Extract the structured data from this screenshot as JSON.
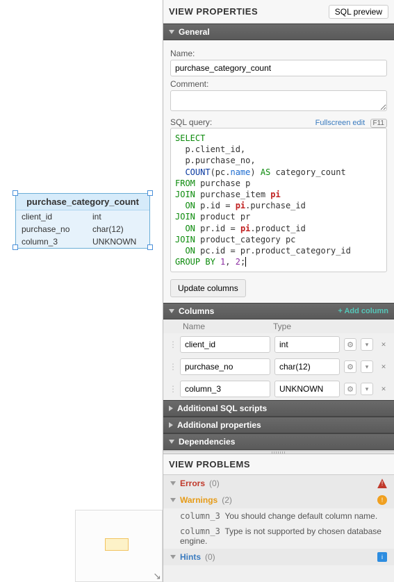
{
  "canvas": {
    "table": {
      "name": "purchase_category_count",
      "columns": [
        {
          "name": "client_id",
          "type": "int"
        },
        {
          "name": "purchase_no",
          "type": "char(12)"
        },
        {
          "name": "column_3",
          "type": "UNKNOWN"
        }
      ]
    }
  },
  "panel": {
    "view_properties_title": "VIEW PROPERTIES",
    "sql_preview_btn": "SQL preview",
    "general": {
      "title": "General",
      "name_label": "Name:",
      "name_value": "purchase_category_count",
      "comment_label": "Comment:",
      "comment_value": "",
      "sql_label": "SQL query:",
      "fullscreen_link": "Fullscreen edit",
      "fullscreen_kbd": "F11",
      "update_btn": "Update columns",
      "sql_tokens": [
        [
          "kw-green",
          "SELECT"
        ],
        [
          "nl",
          ""
        ],
        [
          "indent",
          ""
        ],
        [
          "txt",
          "p.client_id,"
        ],
        [
          "nl",
          ""
        ],
        [
          "indent",
          ""
        ],
        [
          "txt",
          "p.purchase_no,"
        ],
        [
          "nl",
          ""
        ],
        [
          "indent",
          ""
        ],
        [
          "kw-navy",
          "COUNT"
        ],
        [
          "txt",
          "(pc."
        ],
        [
          "kw-blue",
          "name"
        ],
        [
          "txt",
          ") "
        ],
        [
          "kw-green",
          "AS"
        ],
        [
          "txt",
          " category_count"
        ],
        [
          "nl",
          ""
        ],
        [
          "kw-green",
          "FROM"
        ],
        [
          "txt",
          " purchase p"
        ],
        [
          "nl",
          ""
        ],
        [
          "kw-green",
          "JOIN"
        ],
        [
          "txt",
          " purchase_item "
        ],
        [
          "kw-red",
          "pi"
        ],
        [
          "nl",
          ""
        ],
        [
          "indent",
          ""
        ],
        [
          "kw-green",
          "ON"
        ],
        [
          "txt",
          " p.id = "
        ],
        [
          "kw-red",
          "pi"
        ],
        [
          "txt",
          ".purchase_id"
        ],
        [
          "nl",
          ""
        ],
        [
          "kw-green",
          "JOIN"
        ],
        [
          "txt",
          " product pr"
        ],
        [
          "nl",
          ""
        ],
        [
          "indent",
          ""
        ],
        [
          "kw-green",
          "ON"
        ],
        [
          "txt",
          " pr.id = "
        ],
        [
          "kw-red",
          "pi"
        ],
        [
          "txt",
          ".product_id"
        ],
        [
          "nl",
          ""
        ],
        [
          "kw-green",
          "JOIN"
        ],
        [
          "txt",
          " product_category pc"
        ],
        [
          "nl",
          ""
        ],
        [
          "indent",
          ""
        ],
        [
          "kw-green",
          "ON"
        ],
        [
          "txt",
          " pc.id = pr.product_category_id"
        ],
        [
          "nl",
          ""
        ],
        [
          "kw-green",
          "GROUP"
        ],
        [
          "txt",
          " "
        ],
        [
          "kw-green",
          "BY"
        ],
        [
          "txt",
          " "
        ],
        [
          "kw-purple",
          "1"
        ],
        [
          "txt",
          ", "
        ],
        [
          "kw-purple",
          "2"
        ],
        [
          "txt",
          ";"
        ]
      ]
    },
    "columns": {
      "title": "Columns",
      "add_link": "+ Add column",
      "name_header": "Name",
      "type_header": "Type",
      "rows": [
        {
          "name": "client_id",
          "type": "int"
        },
        {
          "name": "purchase_no",
          "type": "char(12)"
        },
        {
          "name": "column_3",
          "type": "UNKNOWN"
        }
      ]
    },
    "additional_sql_title": "Additional SQL scripts",
    "additional_props_title": "Additional properties",
    "dependencies_title": "Dependencies",
    "problems": {
      "title": "VIEW PROBLEMS",
      "errors": {
        "title": "Errors",
        "count": "(0)"
      },
      "warnings": {
        "title": "Warnings",
        "count": "(2)",
        "items": [
          {
            "col": "column_3",
            "text": "You should change default column name."
          },
          {
            "col": "column_3",
            "text": "Type is not supported by chosen database engine."
          }
        ]
      },
      "hints": {
        "title": "Hints",
        "count": "(0)"
      }
    }
  }
}
